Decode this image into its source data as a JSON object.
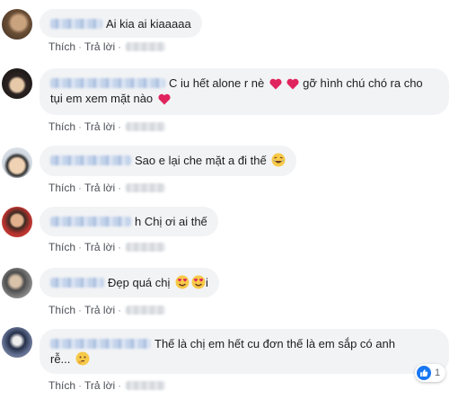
{
  "actions": {
    "like": "Thích",
    "reply": "Trả lời",
    "separator": "·"
  },
  "comments": [
    {
      "text": "Ai kia ai kiaaaaa"
    },
    {
      "text_line1": "C iu hết alone r nè",
      "text_line1b": "gỡ hình chú chó ra cho",
      "text_line2": "tụi em xem mặt nào"
    },
    {
      "text": "Sao e lại che mặt a đi thế"
    },
    {
      "text": "h Chị ơi ai thế"
    },
    {
      "text_a": "Đẹp quá chị",
      "text_b": "i"
    },
    {
      "text_line1": "Thế là chị em hết cu đơn thế là em sắp có anh",
      "text_line2": "rễ..."
    }
  ],
  "reaction": {
    "count": "1",
    "icon": "like-icon",
    "color": "#1877f2"
  },
  "colors": {
    "bubble": "#f2f3f5",
    "heart": "#e0245e",
    "action_text": "#606770"
  }
}
